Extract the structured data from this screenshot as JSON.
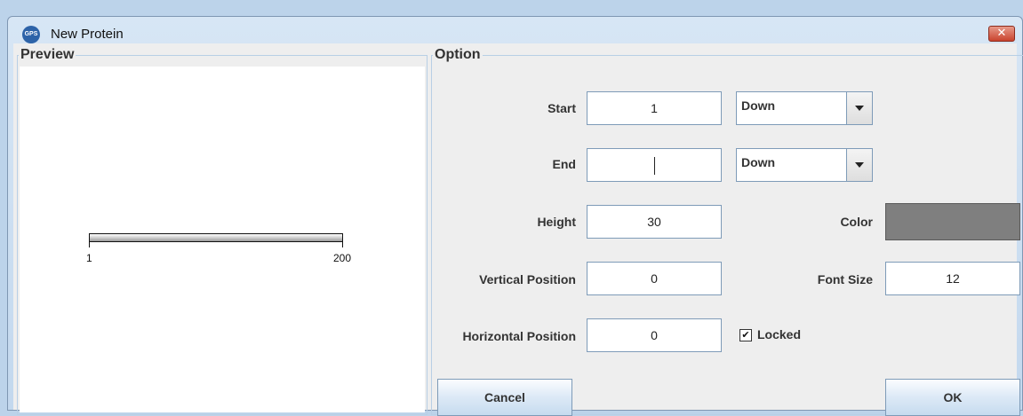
{
  "window": {
    "title": "New Protein",
    "app_icon_text": "GPS",
    "close_symbol": "✕"
  },
  "preview": {
    "legend": "Preview",
    "protein_start": "1",
    "protein_end": "200"
  },
  "option": {
    "legend": "Option",
    "start_label": "Start",
    "start_value": "1",
    "start_direction": "Down",
    "end_label": "End",
    "end_value": "",
    "end_direction": "Down",
    "height_label": "Height",
    "height_value": "30",
    "color_label": "Color",
    "color_value": "#7f7f7f",
    "vertical_label": "Vertical Position",
    "vertical_value": "0",
    "font_size_label": "Font Size",
    "font_size_value": "12",
    "horizontal_label": "Horizontal Position",
    "horizontal_value": "0",
    "locked_label": "Locked",
    "locked_checked": true,
    "check_symbol": "✔"
  },
  "buttons": {
    "cancel": "Cancel",
    "ok": "OK"
  }
}
